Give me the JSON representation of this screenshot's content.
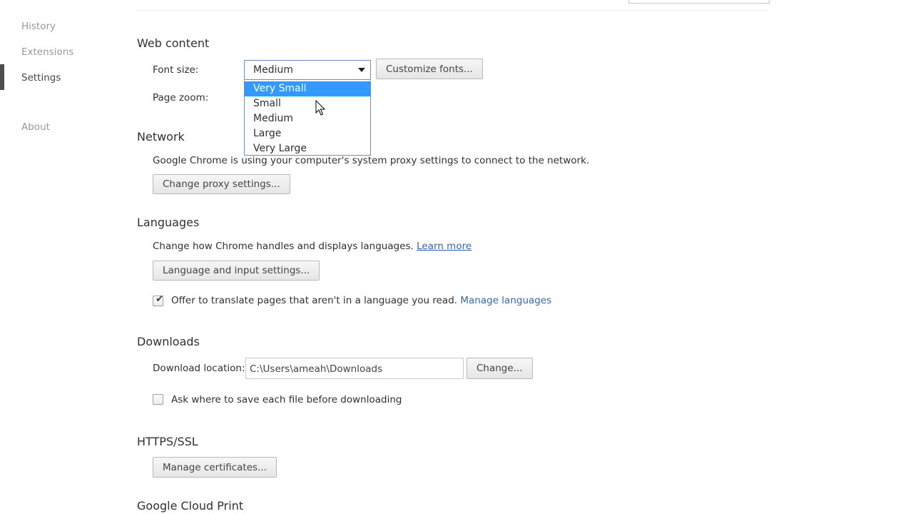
{
  "nav": {
    "items": [
      {
        "label": "History"
      },
      {
        "label": "Extensions"
      },
      {
        "label": "Settings"
      },
      {
        "label": "About"
      }
    ]
  },
  "web_content": {
    "title": "Web content",
    "font_size_label": "Font size:",
    "font_size_value": "Medium",
    "font_size_options": [
      "Very Small",
      "Small",
      "Medium",
      "Large",
      "Very Large"
    ],
    "font_size_highlighted": "Very Small",
    "customize_fonts_button": "Customize fonts...",
    "page_zoom_label": "Page zoom:"
  },
  "network": {
    "title": "Network",
    "description": "Google Chrome is using your computer's system proxy settings to connect to the network.",
    "proxy_button": "Change proxy settings..."
  },
  "languages": {
    "title": "Languages",
    "description": "Change how Chrome handles and displays languages.",
    "learn_more_link": "Learn more",
    "settings_button": "Language and input settings...",
    "translate_checkbox_label": "Offer to translate pages that aren't in a language you read.",
    "translate_checked": true,
    "manage_languages_link": "Manage languages"
  },
  "downloads": {
    "title": "Downloads",
    "location_label": "Download location:",
    "location_value": "C:\\Users\\ameah\\Downloads",
    "change_button": "Change...",
    "ask_checkbox_label": "Ask where to save each file before downloading",
    "ask_checked": false
  },
  "https_ssl": {
    "title": "HTTPS/SSL",
    "certificates_button": "Manage certificates..."
  },
  "cloud_print": {
    "title": "Google Cloud Print"
  }
}
